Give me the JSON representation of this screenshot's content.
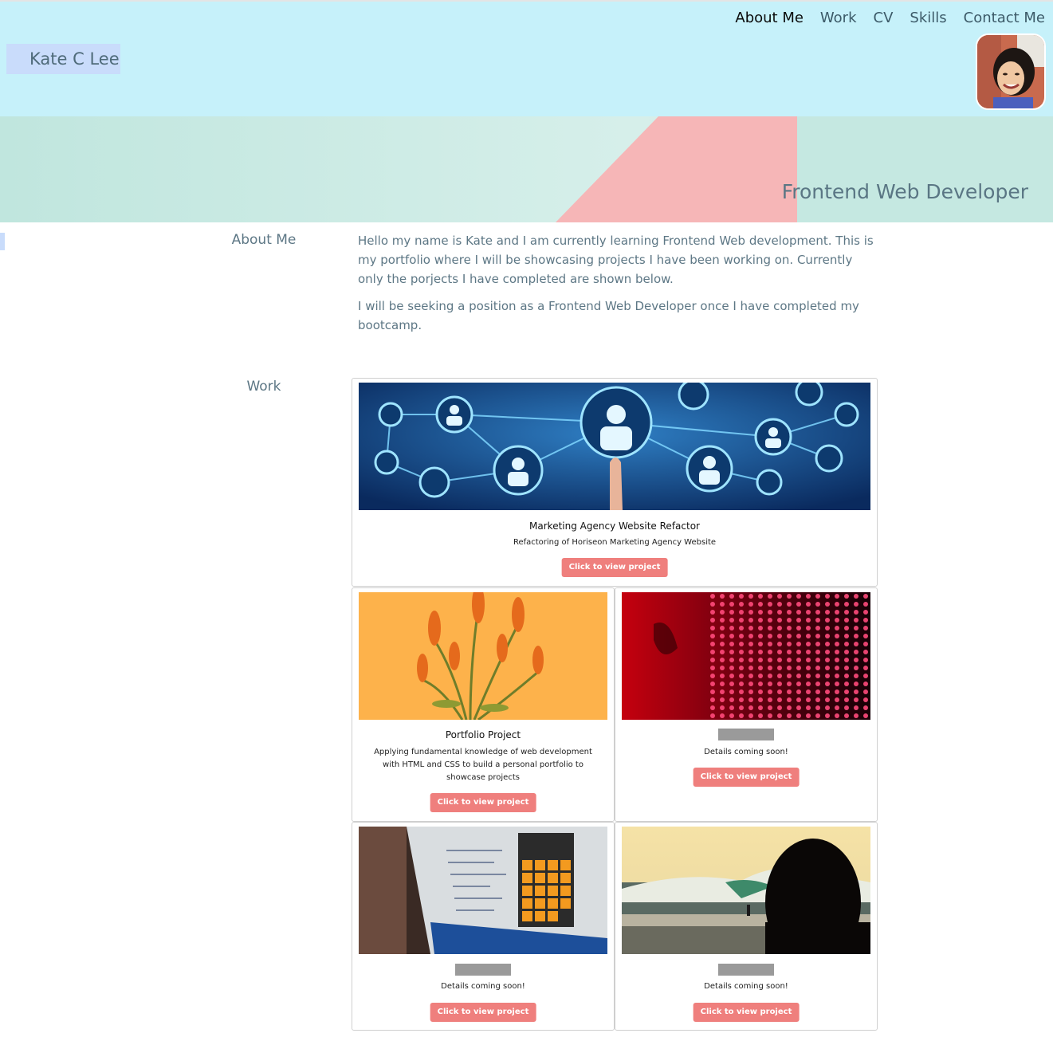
{
  "header": {
    "brand": "Kate C Lee",
    "nav": [
      "About Me",
      "Work",
      "CV",
      "Skills",
      "Contact Me"
    ],
    "active_nav": "About Me"
  },
  "hero": {
    "title": "Frontend Web Developer"
  },
  "about": {
    "label": "About Me",
    "paragraphs": [
      "Hello my name is Kate and I am currently learning Frontend Web development. This is my portfolio where I will be showcasing projects I have been working on. Currently only the porjects I have completed are shown below.",
      "I will be seeking a position as a Frontend Web Developer once I have completed my bootcamp."
    ]
  },
  "work": {
    "label": "Work",
    "button_label": "Click to view project",
    "projects": [
      {
        "title": "Marketing Agency Website Refactor",
        "description": "Refactoring of Horiseon Marketing Agency Website"
      },
      {
        "title": "Portfolio Project",
        "description": "Applying fundamental knowledge of web development with HTML and CSS to build a personal portfolio to showcase projects"
      },
      {
        "title": "",
        "description": "Details coming soon!"
      },
      {
        "title": "",
        "description": "Details coming soon!"
      },
      {
        "title": "",
        "description": "Details coming soon!"
      }
    ]
  },
  "colors": {
    "header_bg": "#c6f1fa",
    "accent_button": "#ef7f7d",
    "hero_pink": "#f6b6b7",
    "hero_mint": "#c8eae4"
  }
}
